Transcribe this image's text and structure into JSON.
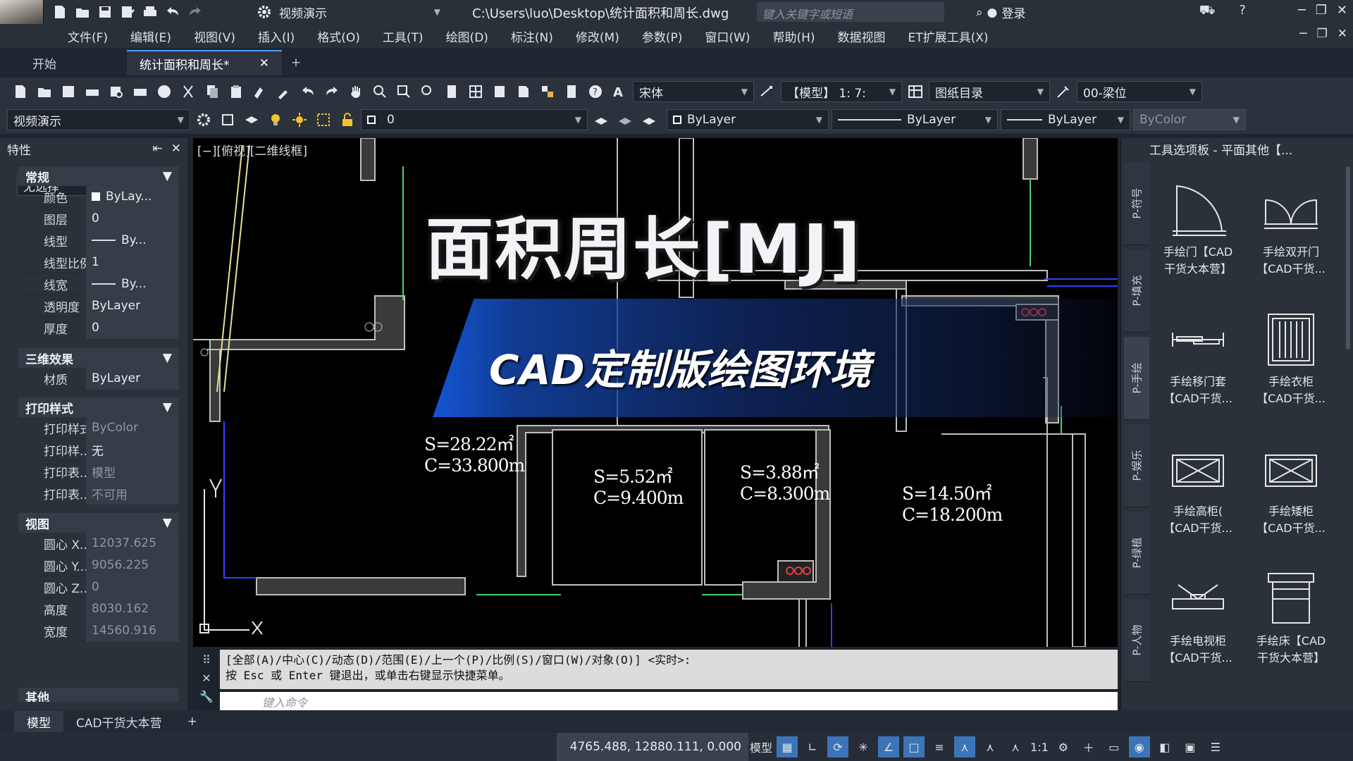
{
  "title_bar": {
    "workspace": "视频演示",
    "file_path": "C:\\Users\\luo\\Desktop\\统计面积和周长.dwg",
    "search_placeholder": "键入关键字或短语",
    "login": "登录"
  },
  "menu": [
    "文件(F)",
    "编辑(E)",
    "视图(V)",
    "插入(I)",
    "格式(O)",
    "工具(T)",
    "绘图(D)",
    "标注(N)",
    "修改(M)",
    "参数(P)",
    "窗口(W)",
    "帮助(H)",
    "数据视图",
    "ET扩展工具(X)"
  ],
  "tabs": {
    "start": "开始",
    "doc": "统计面积和周长*",
    "close": "✕",
    "add": "+"
  },
  "toolbar1": {
    "font": "宋体",
    "scale": "【模型】 1: 7:",
    "sheet_list": "图纸目录",
    "layer_style": "00-梁位"
  },
  "toolbar2": {
    "workspace": "视频演示",
    "layer": "0",
    "color": "ByLayer",
    "linetype": "ByLayer",
    "lineweight": "ByLayer",
    "plotstyle": "ByColor"
  },
  "properties": {
    "title": "特性",
    "selection": "无选择",
    "groups": {
      "general": "常规",
      "threed": "三维效果",
      "plot": "打印样式",
      "view": "视图",
      "misc": "其他"
    },
    "general": [
      {
        "k": "颜色",
        "v": "ByLay..."
      },
      {
        "k": "图层",
        "v": "0"
      },
      {
        "k": "线型",
        "v": "By..."
      },
      {
        "k": "线型比例",
        "v": "1"
      },
      {
        "k": "线宽",
        "v": "By..."
      },
      {
        "k": "透明度",
        "v": "ByLayer"
      },
      {
        "k": "厚度",
        "v": "0"
      }
    ],
    "threed": [
      {
        "k": "材质",
        "v": "ByLayer"
      }
    ],
    "plot": [
      {
        "k": "打印样式",
        "v": "ByColor"
      },
      {
        "k": "打印样...",
        "v": "无"
      },
      {
        "k": "打印表...",
        "v": "模型"
      },
      {
        "k": "打印表...",
        "v": "不可用"
      }
    ],
    "view": [
      {
        "k": "圆心 X...",
        "v": "12037.625"
      },
      {
        "k": "圆心 Y...",
        "v": "9056.225"
      },
      {
        "k": "圆心 Z...",
        "v": "0"
      },
      {
        "k": "高度",
        "v": "8030.162"
      },
      {
        "k": "宽度",
        "v": "14560.916"
      }
    ]
  },
  "canvas": {
    "view_label": "[−][俯视][二维线框]",
    "headline": "面积周长[MJ]",
    "subline": "CAD定制版绘图环境",
    "areas": [
      {
        "s": "S=28.22㎡",
        "c": "C=33.800m"
      },
      {
        "s": "S=5.52㎡",
        "c": "C=9.400m"
      },
      {
        "s": "S=3.88㎡",
        "c": "C=8.300m"
      },
      {
        "s": "S=14.50㎡",
        "c": "C=18.200m"
      }
    ],
    "axis_y": "Y",
    "axis_x": "X"
  },
  "palette": {
    "title": "工具选项板 - 平面其他【...",
    "vtabs": [
      "P-符号",
      "P-填充",
      "P-手绘",
      "P-娱乐",
      "P-绿植",
      "P-人物"
    ],
    "items": [
      {
        "l1": "手绘门【CAD",
        "l2": "干货大本营】"
      },
      {
        "l1": "手绘双开门",
        "l2": "【CAD干货..."
      },
      {
        "l1": "手绘移门套",
        "l2": "【CAD干货..."
      },
      {
        "l1": "手绘衣柜",
        "l2": "【CAD干货..."
      },
      {
        "l1": "手绘高柜(",
        "l2": "【CAD干货..."
      },
      {
        "l1": "手绘矮柜",
        "l2": "【CAD干货..."
      },
      {
        "l1": "手绘电视柜",
        "l2": "【CAD干货..."
      },
      {
        "l1": "手绘床【CAD",
        "l2": "干货大本营】"
      }
    ]
  },
  "command": {
    "line1": "[全部(A)/中心(C)/动态(D)/范围(E)/上一个(P)/比例(S)/窗口(W)/对象(O)] <实时>:",
    "line2": "按 Esc 或 Enter 键退出，或单击右键显示快捷菜单。",
    "placeholder": "键入命令"
  },
  "layout_tabs": [
    "模型",
    "CAD干货大本营",
    "+"
  ],
  "status": {
    "coords": "4765.488, 12880.111, 0.000",
    "model": "模型",
    "scale": "1:1"
  }
}
